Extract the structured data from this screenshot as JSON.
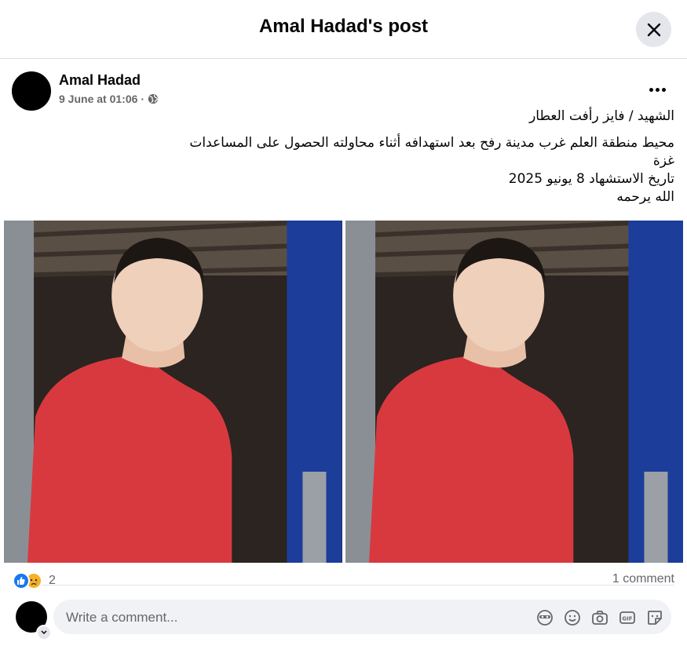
{
  "header": {
    "title": "Amal Hadad's post"
  },
  "post": {
    "author": "Amal Hadad",
    "date": "9 June at 01:06",
    "separator": "·",
    "lines": [
      "الشهيد / فايز رأفت العطار",
      "محيط منطقة العلم غرب مدينة رفح بعد استهدافه أثناء محاولته الحصول على المساعدات",
      "غزة",
      "تاريخ الاستشهاد 8 يونيو 2025",
      "الله يرحمه"
    ]
  },
  "photos": [
    {
      "description": "portrait-red-hoodie"
    },
    {
      "description": "portrait-red-hoodie"
    }
  ],
  "stats": {
    "reaction_icons": [
      "like-icon",
      "sad-icon"
    ],
    "reaction_count": "2",
    "comments": "1 comment"
  },
  "composer": {
    "placeholder": "Write a comment...",
    "icons": [
      "avatar-sticker-icon",
      "emoji-icon",
      "camera-icon",
      "gif-icon",
      "sticker-icon"
    ]
  },
  "colors": {
    "brand_blue": "#1877f2",
    "secondary_text": "#65676b",
    "hoodie_red": "#d8393f"
  }
}
